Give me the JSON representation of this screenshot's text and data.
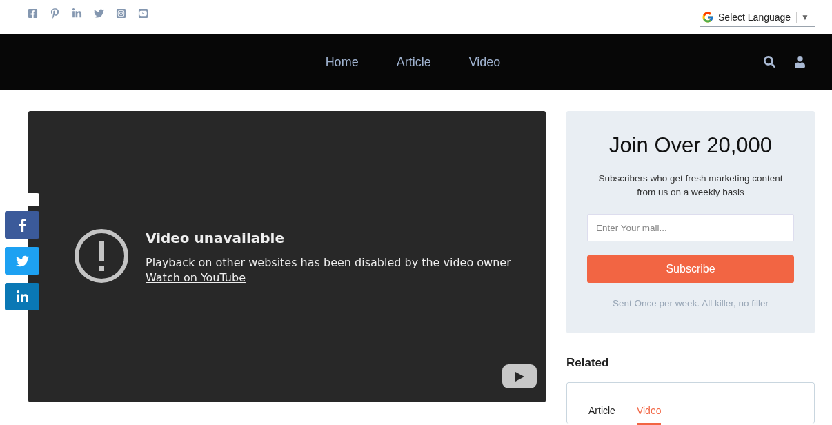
{
  "social_links": [
    {
      "kind": "facebook"
    },
    {
      "kind": "pinterest"
    },
    {
      "kind": "linkedin"
    },
    {
      "kind": "twitter"
    },
    {
      "kind": "instagram"
    },
    {
      "kind": "youtube"
    }
  ],
  "language_selector": {
    "label": "Select Language",
    "caret": "▼"
  },
  "nav": {
    "items": [
      {
        "label": "Home"
      },
      {
        "label": "Article"
      },
      {
        "label": "Video"
      }
    ]
  },
  "video": {
    "title": "Video unavailable",
    "message": "Playback on other websites has been disabled by the video owner",
    "link": "Watch on YouTube"
  },
  "share_buttons": [
    {
      "kind": "facebook"
    },
    {
      "kind": "twitter"
    },
    {
      "kind": "linkedin"
    }
  ],
  "subscribe": {
    "heading": "Join Over 20,000",
    "text": "Subscribers who get fresh marketing content from us on a weekly basis",
    "placeholder": "Enter Your mail...",
    "button": "Subscribe",
    "note": "Sent Once per week. All killer, no filler"
  },
  "related": {
    "heading": "Related",
    "tabs": [
      {
        "label": "Article",
        "selected": false
      },
      {
        "label": "Video",
        "selected": true
      }
    ]
  }
}
